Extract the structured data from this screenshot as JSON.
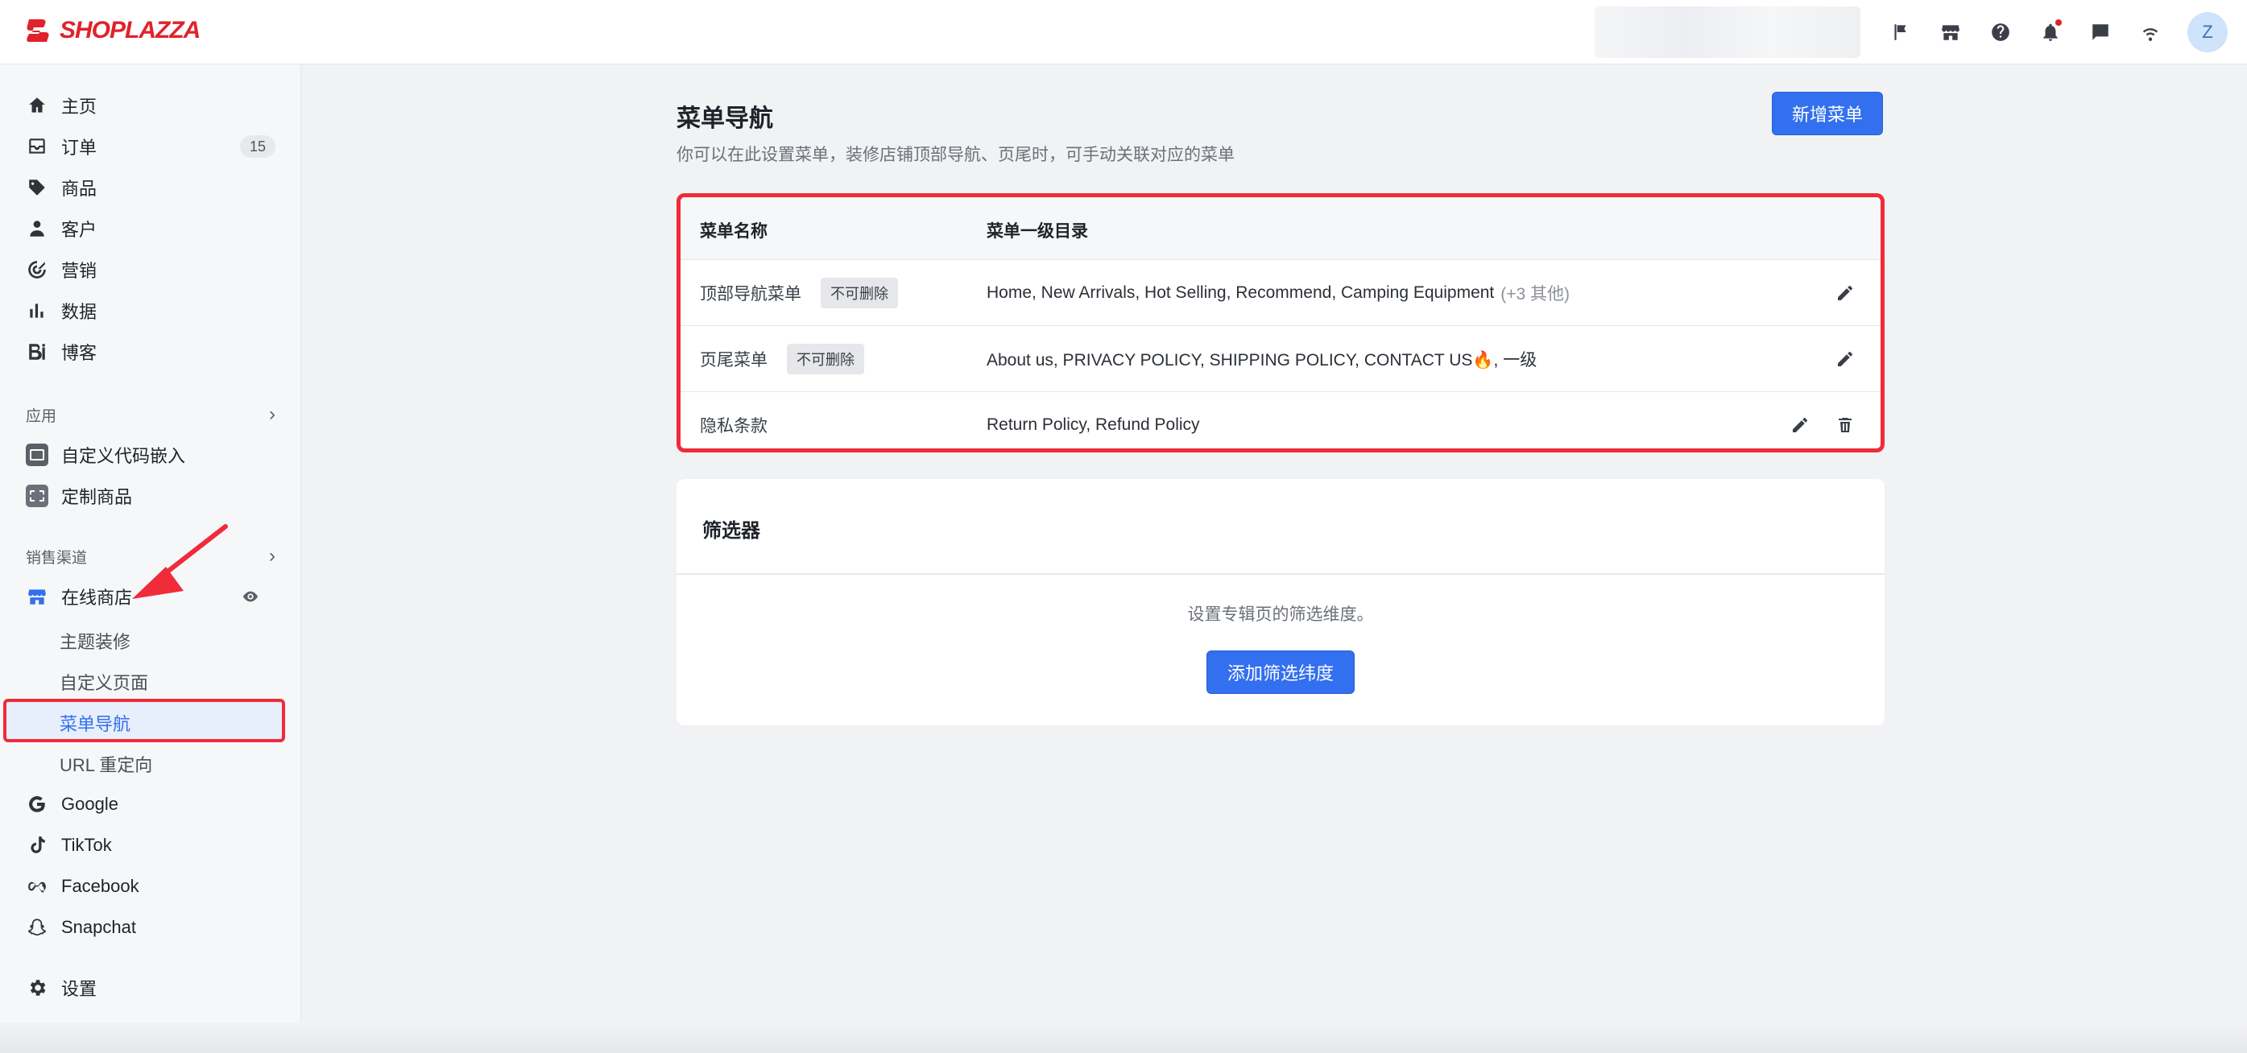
{
  "brand": {
    "logo_text": "SHOPLAZZA",
    "accent": "#3370f0",
    "annotation_red": "#f02b3a"
  },
  "topbar": {
    "icons": [
      "flag-icon",
      "store-icon",
      "help-icon",
      "bell-icon",
      "chat-icon",
      "wifi-icon"
    ],
    "avatar_letter": "Z"
  },
  "sidebar": {
    "items": [
      {
        "label": "主页",
        "icon": "home-icon"
      },
      {
        "label": "订单",
        "icon": "inbox-icon",
        "count": "15"
      },
      {
        "label": "商品",
        "icon": "tag-icon"
      },
      {
        "label": "客户",
        "icon": "person-icon"
      },
      {
        "label": "营销",
        "icon": "target-icon"
      },
      {
        "label": "数据",
        "icon": "bar-chart-icon"
      },
      {
        "label": "博客",
        "icon": "blog-icon"
      }
    ],
    "apps_title": "应用",
    "apps": [
      {
        "label": "自定义代码嵌入",
        "icon": "code-embed-icon"
      },
      {
        "label": "定制商品",
        "icon": "custom-product-icon"
      }
    ],
    "channels_title": "销售渠道",
    "online_store": "在线商店",
    "online_store_sub": [
      "主题装修",
      "自定义页面",
      "菜单导航",
      "URL 重定向"
    ],
    "channels": [
      {
        "label": "Google",
        "icon": "google-icon"
      },
      {
        "label": "TikTok",
        "icon": "tiktok-icon"
      },
      {
        "label": "Facebook",
        "icon": "meta-icon"
      },
      {
        "label": "Snapchat",
        "icon": "snapchat-icon"
      }
    ],
    "settings": "设置"
  },
  "main": {
    "title": "菜单导航",
    "subtitle": "你可以在此设置菜单，装修店铺顶部导航、页尾时，可手动关联对应的菜单",
    "add_button": "新增菜单",
    "table": {
      "headers": [
        "菜单名称",
        "菜单一级目录"
      ],
      "rows": [
        {
          "name": "顶部导航菜单",
          "tag": "不可删除",
          "items": "Home, New Arrivals, Hot Selling, Recommend, Camping Equipment",
          "more": "(+3 其他)"
        },
        {
          "name": "页尾菜单",
          "tag": "不可删除",
          "items": "About us, PRIVACY POLICY, SHIPPING POLICY, CONTACT US🔥, 一级"
        },
        {
          "name": "隐私条款",
          "items": "Return Policy, Refund Policy"
        }
      ]
    },
    "filter": {
      "title": "筛选器",
      "description": "设置专辑页的筛选维度。",
      "button": "添加筛选纬度"
    }
  }
}
